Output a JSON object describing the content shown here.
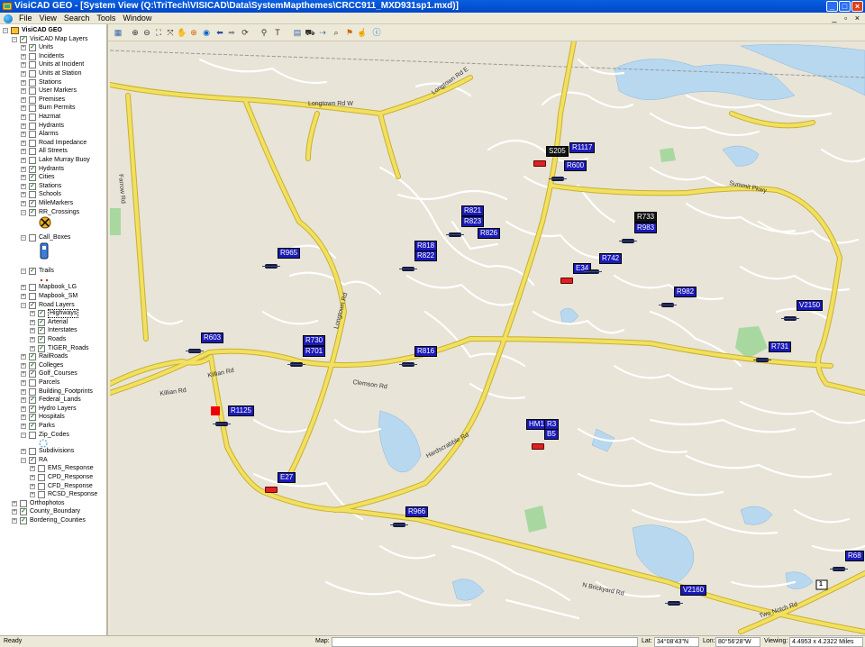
{
  "window": {
    "title": "VisiCAD GEO - [System View (Q:\\TriTech\\VISICAD\\Data\\SystemMapthemes\\CRCC911_MXD931sp1.mxd)]",
    "min": "_",
    "max": "□",
    "close": "×"
  },
  "menu": [
    "File",
    "View",
    "Search",
    "Tools",
    "Window"
  ],
  "mdi_controls": "_ ▫ ×",
  "tree": {
    "root": "VisiCAD GEO",
    "items": [
      {
        "label": "VisiCAD Map Layers",
        "level": 1,
        "exp": "−",
        "checked": true
      },
      {
        "label": "Units",
        "level": 2,
        "exp": "+",
        "checked": true
      },
      {
        "label": "Incidents",
        "level": 2,
        "exp": "+",
        "checked": false
      },
      {
        "label": "Units at Incident",
        "level": 2,
        "exp": "+",
        "checked": false
      },
      {
        "label": "Units at Station",
        "level": 2,
        "exp": "+",
        "checked": false
      },
      {
        "label": "Stations",
        "level": 2,
        "exp": "+",
        "checked": false
      },
      {
        "label": "User Markers",
        "level": 2,
        "exp": "+",
        "checked": false
      },
      {
        "label": "Premises",
        "level": 2,
        "exp": "+",
        "checked": false
      },
      {
        "label": "Burn Permits",
        "level": 2,
        "exp": "+",
        "checked": false
      },
      {
        "label": "Hazmat",
        "level": 2,
        "exp": "+",
        "checked": false
      },
      {
        "label": "Hydrants",
        "level": 2,
        "exp": "+",
        "checked": false
      },
      {
        "label": "Alarms",
        "level": 2,
        "exp": "+",
        "checked": false
      },
      {
        "label": "Road Impedance",
        "level": 2,
        "exp": "+",
        "checked": false
      },
      {
        "label": "All Streets",
        "level": 2,
        "exp": "+",
        "checked": false
      },
      {
        "label": "Lake Murray Buoy",
        "level": 2,
        "exp": "+",
        "checked": false
      },
      {
        "label": "Hydrants",
        "level": 2,
        "exp": "+",
        "checked": true
      },
      {
        "label": "Cities",
        "level": 2,
        "exp": "+",
        "checked": true
      },
      {
        "label": "Stations",
        "level": 2,
        "exp": "+",
        "checked": true
      },
      {
        "label": "Schools",
        "level": 2,
        "exp": "+",
        "checked": false
      },
      {
        "label": "MileMarkers",
        "level": 2,
        "exp": "+",
        "checked": true
      },
      {
        "label": "RR_Crossings",
        "level": 2,
        "exp": "−",
        "checked": true
      },
      {
        "label": "Call_Boxes",
        "level": 2,
        "exp": "−",
        "checked": false
      },
      {
        "label": "Trails",
        "level": 2,
        "exp": "−",
        "checked": true
      },
      {
        "label": "Mapbook_LG",
        "level": 2,
        "exp": "+",
        "checked": false
      },
      {
        "label": "Mapbook_SM",
        "level": 2,
        "exp": "+",
        "checked": false
      },
      {
        "label": "Road Layers",
        "level": 2,
        "exp": "−",
        "checked": true
      },
      {
        "label": "Highways",
        "level": 3,
        "exp": "+",
        "checked": true,
        "selected": true
      },
      {
        "label": "Arterial",
        "level": 3,
        "exp": "+",
        "checked": true
      },
      {
        "label": "Interstates",
        "level": 3,
        "exp": "+",
        "checked": true
      },
      {
        "label": "Roads",
        "level": 3,
        "exp": "+",
        "checked": true
      },
      {
        "label": "TIGER_Roads",
        "level": 3,
        "exp": "+",
        "checked": true
      },
      {
        "label": "RailRoads",
        "level": 2,
        "exp": "+",
        "checked": true
      },
      {
        "label": "Colleges",
        "level": 2,
        "exp": "+",
        "checked": true
      },
      {
        "label": "Golf_Courses",
        "level": 2,
        "exp": "+",
        "checked": true
      },
      {
        "label": "Parcels",
        "level": 2,
        "exp": "+",
        "checked": false
      },
      {
        "label": "Building_Footprints",
        "level": 2,
        "exp": "+",
        "checked": false
      },
      {
        "label": "Federal_Lands",
        "level": 2,
        "exp": "+",
        "checked": true
      },
      {
        "label": "Hydro Layers",
        "level": 2,
        "exp": "+",
        "checked": true
      },
      {
        "label": "Hospitals",
        "level": 2,
        "exp": "+",
        "checked": true
      },
      {
        "label": "Parks",
        "level": 2,
        "exp": "+",
        "checked": true
      },
      {
        "label": "Zip_Codes",
        "level": 2,
        "exp": "−",
        "checked": false
      },
      {
        "label": "Subdivisions",
        "level": 2,
        "exp": "+",
        "checked": false
      },
      {
        "label": "RA",
        "level": 2,
        "exp": "−",
        "checked": true
      },
      {
        "label": "EMS_Response",
        "level": 3,
        "exp": "+",
        "checked": false
      },
      {
        "label": "CPD_Response",
        "level": 3,
        "exp": "+",
        "checked": false
      },
      {
        "label": "CFD_Response",
        "level": 3,
        "exp": "+",
        "checked": false
      },
      {
        "label": "RCSD_Response",
        "level": 3,
        "exp": "+",
        "checked": false
      },
      {
        "label": "Orthophotos",
        "level": 1,
        "exp": "+",
        "checked": false
      },
      {
        "label": "County_Boundary",
        "level": 1,
        "exp": "+",
        "checked": true
      },
      {
        "label": "Bordering_Counties",
        "level": 1,
        "exp": "+",
        "checked": true
      }
    ]
  },
  "toolbar": [
    "table-icon",
    "zoom-in-icon",
    "zoom-out-icon",
    "full-extent-icon",
    "fixed-zoom-icon",
    "pan-icon",
    "zoom-rect-icon",
    "globe-icon",
    "back-icon",
    "forward-icon",
    "refresh-icon",
    "binoculars-icon",
    "text-tool-icon",
    "layout-icon",
    "car-icon",
    "measure-icon",
    "find-icon",
    "route-icon",
    "identify-icon",
    "info-icon"
  ],
  "roads": [
    {
      "name": "Longtown Rd W",
      "angle": 0
    },
    {
      "name": "Longtown Rd E",
      "angle": -35
    },
    {
      "name": "Farrow Rd",
      "angle": 85
    },
    {
      "name": "Summit Pkwy",
      "angle": 12
    },
    {
      "name": "Longtown Rd",
      "angle": -75
    },
    {
      "name": "Clemson Rd",
      "angle": 8
    },
    {
      "name": "Killian Rd",
      "angle": -8
    },
    {
      "name": "Killian Rd",
      "angle": -12
    },
    {
      "name": "Hardscrabble Rd",
      "angle": -28
    },
    {
      "name": "N Brickyard Rd",
      "angle": 12
    },
    {
      "name": "Two Notch Rd",
      "angle": -18
    }
  ],
  "units": [
    {
      "id": "S205",
      "style": "dark",
      "kind": "truck"
    },
    {
      "id": "R1117",
      "style": "blue",
      "kind": "none"
    },
    {
      "id": "R600",
      "style": "blue",
      "kind": "car"
    },
    {
      "id": "R821",
      "style": "blue",
      "kind": "none"
    },
    {
      "id": "R823",
      "style": "blue",
      "kind": "car"
    },
    {
      "id": "R826",
      "style": "blue",
      "kind": "none"
    },
    {
      "id": "R733",
      "style": "dark",
      "kind": "none"
    },
    {
      "id": "R983",
      "style": "blue",
      "kind": "car"
    },
    {
      "id": "R818",
      "style": "blue",
      "kind": "none"
    },
    {
      "id": "R822",
      "style": "blue",
      "kind": "car"
    },
    {
      "id": "R965",
      "style": "blue",
      "kind": "car"
    },
    {
      "id": "E34",
      "style": "blue",
      "kind": "truck"
    },
    {
      "id": "R742",
      "style": "blue",
      "kind": "car"
    },
    {
      "id": "R982",
      "style": "blue",
      "kind": "car"
    },
    {
      "id": "V2150",
      "style": "blue",
      "kind": "car"
    },
    {
      "id": "R603",
      "style": "blue",
      "kind": "car"
    },
    {
      "id": "R730",
      "style": "blue",
      "kind": "none"
    },
    {
      "id": "R701",
      "style": "blue",
      "kind": "car"
    },
    {
      "id": "R816",
      "style": "blue",
      "kind": "car"
    },
    {
      "id": "R731",
      "style": "blue",
      "kind": "car"
    },
    {
      "id": "R1125",
      "style": "blue",
      "kind": "car"
    },
    {
      "id": "HM1",
      "style": "blue",
      "kind": "none"
    },
    {
      "id": "R3",
      "style": "blue",
      "kind": "none"
    },
    {
      "id": "B5",
      "style": "blue",
      "kind": "truck"
    },
    {
      "id": "E27",
      "style": "blue",
      "kind": "truck"
    },
    {
      "id": "R966",
      "style": "blue",
      "kind": "car"
    },
    {
      "id": "R68",
      "style": "blue",
      "kind": "car"
    },
    {
      "id": "V2160",
      "style": "blue",
      "kind": "car"
    }
  ],
  "route_shield": "1",
  "status": {
    "ready": "Ready",
    "map_label": "Map:",
    "lat_label": "Lat:",
    "lat": "34°08'43\"N",
    "lon_label": "Lon:",
    "lon": "80°56'28\"W",
    "viewing_label": "Viewing:",
    "viewing": "4.4953 x 4.2322 Miles"
  },
  "colors": {
    "highway": "#f2e060",
    "highway_edge": "#c8b030",
    "street": "#ffffff",
    "water": "#b8d8f0",
    "park": "#a8d8a0",
    "land": "#e8e4d8",
    "unit_label": "#1a1ab8"
  }
}
